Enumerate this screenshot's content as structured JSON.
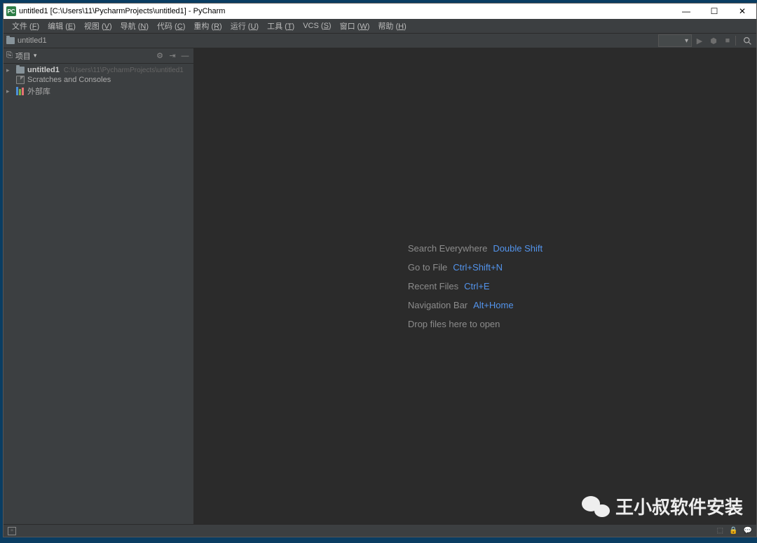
{
  "titlebar": {
    "icon_text": "PC",
    "title": "untitled1 [C:\\Users\\11\\PycharmProjects\\untitled1] - PyCharm"
  },
  "menu": [
    {
      "label": "文件",
      "key": "F"
    },
    {
      "label": "编辑",
      "key": "E"
    },
    {
      "label": "视图",
      "key": "V"
    },
    {
      "label": "导航",
      "key": "N"
    },
    {
      "label": "代码",
      "key": "C"
    },
    {
      "label": "重构",
      "key": "R"
    },
    {
      "label": "运行",
      "key": "U"
    },
    {
      "label": "工具",
      "key": "T"
    },
    {
      "label": "VCS",
      "key": "S"
    },
    {
      "label": "窗口",
      "key": "W"
    },
    {
      "label": "帮助",
      "key": "H"
    }
  ],
  "breadcrumb": {
    "project": "untitled1"
  },
  "config_dropdown": "▾",
  "sidebar": {
    "title": "项目",
    "tree": {
      "project": {
        "name": "untitled1",
        "path": "C:\\Users\\11\\PycharmProjects\\untitled1"
      },
      "scratches": "Scratches and Consoles",
      "external": "外部库"
    }
  },
  "hints": [
    {
      "label": "Search Everywhere",
      "key": "Double Shift"
    },
    {
      "label": "Go to File",
      "key": "Ctrl+Shift+N"
    },
    {
      "label": "Recent Files",
      "key": "Ctrl+E"
    },
    {
      "label": "Navigation Bar",
      "key": "Alt+Home"
    },
    {
      "label": "Drop files here to open",
      "key": ""
    }
  ],
  "watermark": "王小叔软件安装"
}
